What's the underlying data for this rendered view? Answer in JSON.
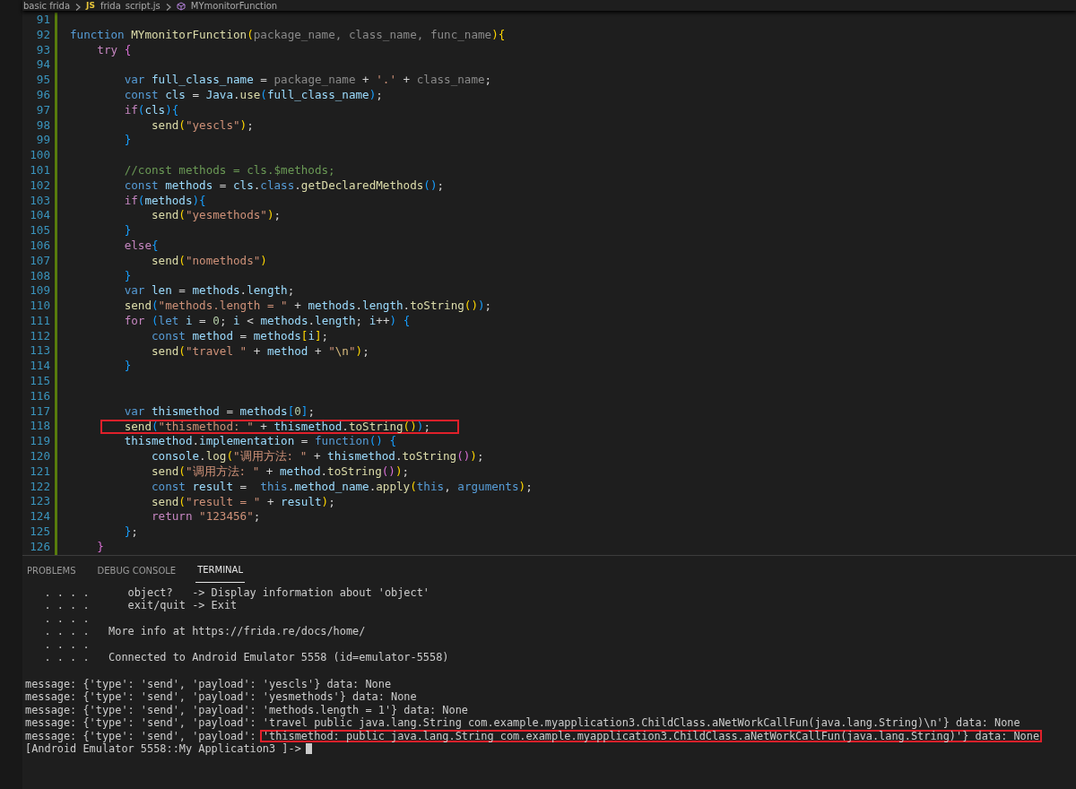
{
  "breadcrumb": {
    "folder": "basic frida",
    "file_badge": "JS",
    "file": "frida_script.js",
    "symbol": "MYmonitorFunction"
  },
  "editor": {
    "lines": [
      {
        "num": "91"
      },
      {
        "num": "92",
        "tokens": [
          {
            "kind": "kw",
            "text": "function "
          },
          {
            "kind": "fn",
            "text": "MYmonitorFunction"
          },
          {
            "kind": "b1",
            "text": "("
          },
          {
            "kind": "dim",
            "text": "package_name, class_name, func_name"
          },
          {
            "kind": "b1",
            "text": ")"
          },
          {
            "kind": "b1",
            "text": "{"
          }
        ]
      },
      {
        "num": "93",
        "tokens": [
          {
            "kind": "ctl",
            "text": "    try "
          },
          {
            "kind": "b2",
            "text": "{"
          }
        ]
      },
      {
        "num": "94"
      },
      {
        "num": "95",
        "tokens": [
          {
            "kind": "kw",
            "text": "        var "
          },
          {
            "kind": "var",
            "text": "full_class_name"
          },
          {
            "kind": "p",
            "text": " = "
          },
          {
            "kind": "dim",
            "text": "package_name"
          },
          {
            "kind": "p",
            "text": " + "
          },
          {
            "kind": "str",
            "text": "'.'"
          },
          {
            "kind": "p",
            "text": " + "
          },
          {
            "kind": "dim",
            "text": "class_name"
          },
          {
            "kind": "p",
            "text": ";"
          }
        ]
      },
      {
        "num": "96",
        "tokens": [
          {
            "kind": "kw",
            "text": "        const "
          },
          {
            "kind": "var",
            "text": "cls"
          },
          {
            "kind": "p",
            "text": " = "
          },
          {
            "kind": "var",
            "text": "Java"
          },
          {
            "kind": "p",
            "text": "."
          },
          {
            "kind": "fn",
            "text": "use"
          },
          {
            "kind": "b3",
            "text": "("
          },
          {
            "kind": "var",
            "text": "full_class_name"
          },
          {
            "kind": "b3",
            "text": ")"
          },
          {
            "kind": "p",
            "text": ";"
          }
        ]
      },
      {
        "num": "97",
        "tokens": [
          {
            "kind": "ctl",
            "text": "        if"
          },
          {
            "kind": "b3",
            "text": "("
          },
          {
            "kind": "var",
            "text": "cls"
          },
          {
            "kind": "b3",
            "text": ")"
          },
          {
            "kind": "b3",
            "text": "{"
          }
        ]
      },
      {
        "num": "98",
        "tokens": [
          {
            "kind": "fn",
            "text": "            send"
          },
          {
            "kind": "b1",
            "text": "("
          },
          {
            "kind": "str",
            "text": "\"yescls\""
          },
          {
            "kind": "b1",
            "text": ")"
          },
          {
            "kind": "p",
            "text": ";"
          }
        ]
      },
      {
        "num": "99",
        "tokens": [
          {
            "kind": "b3",
            "text": "        }"
          }
        ]
      },
      {
        "num": "100"
      },
      {
        "num": "101",
        "tokens": [
          {
            "kind": "com",
            "text": "        //const methods = cls.$methods;"
          }
        ]
      },
      {
        "num": "102",
        "tokens": [
          {
            "kind": "kw",
            "text": "        const "
          },
          {
            "kind": "var",
            "text": "methods"
          },
          {
            "kind": "p",
            "text": " = "
          },
          {
            "kind": "var",
            "text": "cls"
          },
          {
            "kind": "p",
            "text": "."
          },
          {
            "kind": "kw",
            "text": "class"
          },
          {
            "kind": "p",
            "text": "."
          },
          {
            "kind": "fn",
            "text": "getDeclaredMethods"
          },
          {
            "kind": "b3",
            "text": "()"
          },
          {
            "kind": "p",
            "text": ";"
          }
        ]
      },
      {
        "num": "103",
        "tokens": [
          {
            "kind": "ctl",
            "text": "        if"
          },
          {
            "kind": "b3",
            "text": "("
          },
          {
            "kind": "var",
            "text": "methods"
          },
          {
            "kind": "b3",
            "text": ")"
          },
          {
            "kind": "b3",
            "text": "{"
          }
        ]
      },
      {
        "num": "104",
        "tokens": [
          {
            "kind": "fn",
            "text": "            send"
          },
          {
            "kind": "b1",
            "text": "("
          },
          {
            "kind": "str",
            "text": "\"yesmethods\""
          },
          {
            "kind": "b1",
            "text": ")"
          },
          {
            "kind": "p",
            "text": ";"
          }
        ]
      },
      {
        "num": "105",
        "tokens": [
          {
            "kind": "b3",
            "text": "        }"
          }
        ]
      },
      {
        "num": "106",
        "tokens": [
          {
            "kind": "ctl",
            "text": "        else"
          },
          {
            "kind": "b3",
            "text": "{"
          }
        ]
      },
      {
        "num": "107",
        "tokens": [
          {
            "kind": "fn",
            "text": "            send"
          },
          {
            "kind": "b1",
            "text": "("
          },
          {
            "kind": "str",
            "text": "\"nomethods\""
          },
          {
            "kind": "b1",
            "text": ")"
          }
        ]
      },
      {
        "num": "108",
        "tokens": [
          {
            "kind": "b3",
            "text": "        }"
          }
        ]
      },
      {
        "num": "109",
        "tokens": [
          {
            "kind": "kw",
            "text": "        var "
          },
          {
            "kind": "var",
            "text": "len"
          },
          {
            "kind": "p",
            "text": " = "
          },
          {
            "kind": "var",
            "text": "methods"
          },
          {
            "kind": "p",
            "text": "."
          },
          {
            "kind": "var",
            "text": "length"
          },
          {
            "kind": "p",
            "text": ";"
          }
        ]
      },
      {
        "num": "110",
        "tokens": [
          {
            "kind": "fn",
            "text": "        send"
          },
          {
            "kind": "b3",
            "text": "("
          },
          {
            "kind": "str",
            "text": "\"methods.length = \""
          },
          {
            "kind": "p",
            "text": " + "
          },
          {
            "kind": "var",
            "text": "methods"
          },
          {
            "kind": "p",
            "text": "."
          },
          {
            "kind": "var",
            "text": "length"
          },
          {
            "kind": "p",
            "text": "."
          },
          {
            "kind": "fn",
            "text": "toString"
          },
          {
            "kind": "b1",
            "text": "()"
          },
          {
            "kind": "b3",
            "text": ")"
          },
          {
            "kind": "p",
            "text": ";"
          }
        ]
      },
      {
        "num": "111",
        "tokens": [
          {
            "kind": "ctl",
            "text": "        for "
          },
          {
            "kind": "b3",
            "text": "("
          },
          {
            "kind": "kw",
            "text": "let "
          },
          {
            "kind": "var",
            "text": "i"
          },
          {
            "kind": "p",
            "text": " = "
          },
          {
            "kind": "num",
            "text": "0"
          },
          {
            "kind": "p",
            "text": "; "
          },
          {
            "kind": "var",
            "text": "i"
          },
          {
            "kind": "p",
            "text": " < "
          },
          {
            "kind": "var",
            "text": "methods"
          },
          {
            "kind": "p",
            "text": "."
          },
          {
            "kind": "var",
            "text": "length"
          },
          {
            "kind": "p",
            "text": "; "
          },
          {
            "kind": "var",
            "text": "i"
          },
          {
            "kind": "p",
            "text": "++"
          },
          {
            "kind": "b3",
            "text": ") {"
          }
        ]
      },
      {
        "num": "112",
        "tokens": [
          {
            "kind": "kw",
            "text": "            const "
          },
          {
            "kind": "var",
            "text": "method"
          },
          {
            "kind": "p",
            "text": " = "
          },
          {
            "kind": "var",
            "text": "methods"
          },
          {
            "kind": "b1",
            "text": "["
          },
          {
            "kind": "var",
            "text": "i"
          },
          {
            "kind": "b1",
            "text": "]"
          },
          {
            "kind": "p",
            "text": ";"
          }
        ]
      },
      {
        "num": "113",
        "tokens": [
          {
            "kind": "fn",
            "text": "            send"
          },
          {
            "kind": "b1",
            "text": "("
          },
          {
            "kind": "str",
            "text": "\"travel \""
          },
          {
            "kind": "p",
            "text": " + "
          },
          {
            "kind": "var",
            "text": "method"
          },
          {
            "kind": "p",
            "text": " + "
          },
          {
            "kind": "str",
            "text": "\""
          },
          {
            "kind": "esc",
            "text": "\\n"
          },
          {
            "kind": "str",
            "text": "\""
          },
          {
            "kind": "b1",
            "text": ")"
          },
          {
            "kind": "p",
            "text": ";"
          }
        ]
      },
      {
        "num": "114",
        "tokens": [
          {
            "kind": "b3",
            "text": "        }"
          }
        ]
      },
      {
        "num": "115"
      },
      {
        "num": "116"
      },
      {
        "num": "117",
        "tokens": [
          {
            "kind": "kw",
            "text": "        var "
          },
          {
            "kind": "var",
            "text": "thismethod"
          },
          {
            "kind": "p",
            "text": " = "
          },
          {
            "kind": "var",
            "text": "methods"
          },
          {
            "kind": "b3",
            "text": "["
          },
          {
            "kind": "num",
            "text": "0"
          },
          {
            "kind": "b3",
            "text": "]"
          },
          {
            "kind": "p",
            "text": ";"
          }
        ]
      },
      {
        "num": "118",
        "highlighted": true,
        "tokens": [
          {
            "kind": "fn",
            "text": "        send"
          },
          {
            "kind": "b3",
            "text": "("
          },
          {
            "kind": "str",
            "text": "\"thismethod: \""
          },
          {
            "kind": "p",
            "text": " + "
          },
          {
            "kind": "var",
            "text": "thismethod"
          },
          {
            "kind": "p",
            "text": "."
          },
          {
            "kind": "fn",
            "text": "toString"
          },
          {
            "kind": "b1",
            "text": "()"
          },
          {
            "kind": "b3",
            "text": ")"
          },
          {
            "kind": "p",
            "text": ";"
          }
        ]
      },
      {
        "num": "119",
        "tokens": [
          {
            "kind": "var",
            "text": "        thismethod"
          },
          {
            "kind": "p",
            "text": "."
          },
          {
            "kind": "var",
            "text": "implementation"
          },
          {
            "kind": "p",
            "text": " = "
          },
          {
            "kind": "kw",
            "text": "function"
          },
          {
            "kind": "b3",
            "text": "() {"
          }
        ]
      },
      {
        "num": "120",
        "tokens": [
          {
            "kind": "var",
            "text": "            console"
          },
          {
            "kind": "p",
            "text": "."
          },
          {
            "kind": "fn",
            "text": "log"
          },
          {
            "kind": "b1",
            "text": "("
          },
          {
            "kind": "str",
            "text": "\"调用方法: \""
          },
          {
            "kind": "p",
            "text": " + "
          },
          {
            "kind": "var",
            "text": "thismethod"
          },
          {
            "kind": "p",
            "text": "."
          },
          {
            "kind": "fn",
            "text": "toString"
          },
          {
            "kind": "b2",
            "text": "()"
          },
          {
            "kind": "b1",
            "text": ")"
          },
          {
            "kind": "p",
            "text": ";"
          }
        ]
      },
      {
        "num": "121",
        "tokens": [
          {
            "kind": "fn",
            "text": "            send"
          },
          {
            "kind": "b1",
            "text": "("
          },
          {
            "kind": "str",
            "text": "\"调用方法: \""
          },
          {
            "kind": "p",
            "text": " + "
          },
          {
            "kind": "var",
            "text": "method"
          },
          {
            "kind": "p",
            "text": "."
          },
          {
            "kind": "fn",
            "text": "toString"
          },
          {
            "kind": "b2",
            "text": "()"
          },
          {
            "kind": "b1",
            "text": ")"
          },
          {
            "kind": "p",
            "text": ";"
          }
        ]
      },
      {
        "num": "122",
        "tokens": [
          {
            "kind": "kw",
            "text": "            const "
          },
          {
            "kind": "var",
            "text": "result"
          },
          {
            "kind": "p",
            "text": " =  "
          },
          {
            "kind": "kw",
            "text": "this"
          },
          {
            "kind": "p",
            "text": "."
          },
          {
            "kind": "var",
            "text": "method_name"
          },
          {
            "kind": "p",
            "text": "."
          },
          {
            "kind": "fn",
            "text": "apply"
          },
          {
            "kind": "b1",
            "text": "("
          },
          {
            "kind": "kw",
            "text": "this"
          },
          {
            "kind": "p",
            "text": ", "
          },
          {
            "kind": "kw",
            "text": "arguments"
          },
          {
            "kind": "b1",
            "text": ")"
          },
          {
            "kind": "p",
            "text": ";"
          }
        ]
      },
      {
        "num": "123",
        "tokens": [
          {
            "kind": "fn",
            "text": "            send"
          },
          {
            "kind": "b1",
            "text": "("
          },
          {
            "kind": "str",
            "text": "\"result = \""
          },
          {
            "kind": "p",
            "text": " + "
          },
          {
            "kind": "var",
            "text": "result"
          },
          {
            "kind": "b1",
            "text": ")"
          },
          {
            "kind": "p",
            "text": ";"
          }
        ]
      },
      {
        "num": "124",
        "tokens": [
          {
            "kind": "ctl",
            "text": "            return "
          },
          {
            "kind": "str",
            "text": "\"123456\""
          },
          {
            "kind": "p",
            "text": ";"
          }
        ]
      },
      {
        "num": "125",
        "tokens": [
          {
            "kind": "b3",
            "text": "        }"
          },
          {
            "kind": "p",
            "text": ";"
          }
        ]
      },
      {
        "num": "126",
        "tokens": [
          {
            "kind": "b2",
            "text": "    }"
          }
        ]
      }
    ]
  },
  "panel": {
    "tabs": [
      {
        "label": "PROBLEMS",
        "selected": false
      },
      {
        "label": "DEBUG CONSOLE",
        "selected": false
      },
      {
        "label": "TERMINAL",
        "selected": true
      }
    ],
    "terminal": {
      "banner": [
        "   . . . .      object?   -> Display information about 'object'",
        "   . . . .      exit/quit -> Exit",
        "   . . . .",
        "   . . . .   More info at https://frida.re/docs/home/",
        "   . . . .",
        "   . . . .   Connected to Android Emulator 5558 (id=emulator-5558)"
      ],
      "messages": [
        {
          "text": "message: {'type': 'send', 'payload': 'yescls'} data: None"
        },
        {
          "text": "message: {'type': 'send', 'payload': 'yesmethods'} data: None"
        },
        {
          "text": "message: {'type': 'send', 'payload': 'methods.length = 1'} data: None"
        },
        {
          "text": "message: {'type': 'send', 'payload': 'travel public java.lang.String com.example.myapplication3.ChildClass.aNetWorkCallFun(java.lang.String)\\n'} data: None"
        },
        {
          "text": "message: {'type': 'send', 'payload': ",
          "highlight": "'thismethod: public java.lang.String com.example.myapplication3.ChildClass.aNetWorkCallFun(java.lang.String)'} data: None"
        }
      ],
      "prompt": "[Android Emulator 5558::My Application3 ]->"
    }
  }
}
